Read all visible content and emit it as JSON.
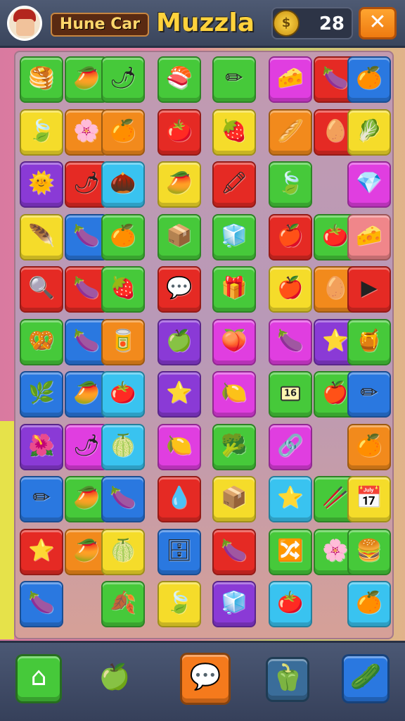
{
  "header": {
    "player_label": "Hune Car",
    "game_title": "Muzzla",
    "coin_symbol": "$",
    "coin_count": "28",
    "close_symbol": "✕"
  },
  "colors": {
    "green": "#46c93a",
    "orange": "#f28a1c",
    "yellow": "#f5dc2a",
    "red": "#e52a24",
    "purple": "#8a3ad6",
    "blue": "#2a78e0",
    "cyan": "#39c3f0",
    "magenta": "#e03ee0",
    "pink": "#f0868a"
  },
  "tiles": [
    {
      "col": 0,
      "row": 0,
      "color": "green",
      "icon": "🥞",
      "name": "pancake-icon"
    },
    {
      "col": 1,
      "row": 0,
      "color": "green",
      "icon": "🥭",
      "name": "mango-icon"
    },
    {
      "col": 2,
      "row": 0,
      "color": "green",
      "icon": "🌶",
      "name": "pepper-icon"
    },
    {
      "col": 3,
      "row": 0,
      "color": "green",
      "icon": "🍣",
      "name": "sushi-icon"
    },
    {
      "col": 4,
      "row": 0,
      "color": "green",
      "icon": "✏",
      "name": "pencil-icon"
    },
    {
      "col": 5,
      "row": 0,
      "color": "magenta",
      "icon": "🧀",
      "name": "cheese-icon"
    },
    {
      "col": 6,
      "row": 0,
      "color": "red",
      "icon": "🍆",
      "name": "eggplant-icon"
    },
    {
      "col": 7,
      "row": 0,
      "color": "blue",
      "icon": "🍊",
      "name": "orange-icon"
    },
    {
      "col": 0,
      "row": 1,
      "color": "yellow",
      "icon": "🍃",
      "name": "leaf-icon"
    },
    {
      "col": 1,
      "row": 1,
      "color": "orange",
      "icon": "🌸",
      "name": "flower-icon"
    },
    {
      "col": 2,
      "row": 1,
      "color": "orange",
      "icon": "🍊",
      "name": "orange-icon"
    },
    {
      "col": 3,
      "row": 1,
      "color": "red",
      "icon": "🍅",
      "name": "tomato-icon"
    },
    {
      "col": 4,
      "row": 1,
      "color": "yellow",
      "icon": "🍓",
      "name": "berry-icon"
    },
    {
      "col": 5,
      "row": 1,
      "color": "orange",
      "icon": "🥖",
      "name": "bread-icon"
    },
    {
      "col": 6,
      "row": 1,
      "color": "red",
      "icon": "🥚",
      "name": "egg-icon"
    },
    {
      "col": 7,
      "row": 1,
      "color": "yellow",
      "icon": "🥬",
      "name": "cabbage-icon"
    },
    {
      "col": 0,
      "row": 2,
      "color": "purple",
      "icon": "🌞",
      "name": "sun-icon"
    },
    {
      "col": 1,
      "row": 2,
      "color": "red",
      "icon": "🌶",
      "name": "pepper-icon"
    },
    {
      "col": 2,
      "row": 2,
      "color": "cyan",
      "icon": "🌰",
      "name": "chestnut-icon"
    },
    {
      "col": 3,
      "row": 2,
      "color": "yellow",
      "icon": "🥭",
      "name": "mango-icon"
    },
    {
      "col": 4,
      "row": 2,
      "color": "red",
      "icon": "🖍",
      "name": "crayon-icon"
    },
    {
      "col": 5,
      "row": 2,
      "color": "green",
      "icon": "🍃",
      "name": "leaf-icon"
    },
    {
      "col": 7,
      "row": 2,
      "color": "magenta",
      "icon": "💎",
      "name": "gem-icon"
    },
    {
      "col": 0,
      "row": 3,
      "color": "yellow",
      "icon": "🪶",
      "name": "feather-icon"
    },
    {
      "col": 1,
      "row": 3,
      "color": "blue",
      "icon": "🍆",
      "name": "plum-icon"
    },
    {
      "col": 2,
      "row": 3,
      "color": "green",
      "icon": "🍊",
      "name": "orange-icon"
    },
    {
      "col": 3,
      "row": 3,
      "color": "green",
      "icon": "📦",
      "name": "box-icon"
    },
    {
      "col": 4,
      "row": 3,
      "color": "green",
      "icon": "🧊",
      "name": "cube-icon"
    },
    {
      "col": 5,
      "row": 3,
      "color": "red",
      "icon": "🍎",
      "name": "apple-icon"
    },
    {
      "col": 6,
      "row": 3,
      "color": "green",
      "icon": "🍅",
      "name": "tomato-icon"
    },
    {
      "col": 7,
      "row": 3,
      "color": "pink",
      "icon": "🧀",
      "name": "cheese-icon"
    },
    {
      "col": 0,
      "row": 4,
      "color": "red",
      "icon": "🔍",
      "name": "magnifier-icon"
    },
    {
      "col": 1,
      "row": 4,
      "color": "red",
      "icon": "🍆",
      "name": "eggplant-icon"
    },
    {
      "col": 2,
      "row": 4,
      "color": "green",
      "icon": "🍓",
      "name": "strawberry-icon"
    },
    {
      "col": 3,
      "row": 4,
      "color": "red",
      "icon": "💬",
      "name": "speech-bubble-icon"
    },
    {
      "col": 4,
      "row": 4,
      "color": "green",
      "icon": "🎁",
      "name": "gift-box-icon"
    },
    {
      "col": 5,
      "row": 4,
      "color": "yellow",
      "icon": "🍎",
      "name": "apple-icon"
    },
    {
      "col": 6,
      "row": 4,
      "color": "orange",
      "icon": "🥚",
      "name": "egg-icon"
    },
    {
      "col": 7,
      "row": 4,
      "color": "red",
      "icon": "▶",
      "name": "play-icon"
    },
    {
      "col": 0,
      "row": 5,
      "color": "green",
      "icon": "🥨",
      "name": "pretzel-icon"
    },
    {
      "col": 1,
      "row": 5,
      "color": "blue",
      "icon": "🍆",
      "name": "plum-icon"
    },
    {
      "col": 2,
      "row": 5,
      "color": "orange",
      "icon": "🥫",
      "name": "can-icon"
    },
    {
      "col": 3,
      "row": 5,
      "color": "purple",
      "icon": "🍏",
      "name": "lime-icon"
    },
    {
      "col": 4,
      "row": 5,
      "color": "magenta",
      "icon": "🍑",
      "name": "peach-icon"
    },
    {
      "col": 5,
      "row": 5,
      "color": "magenta",
      "icon": "🍆",
      "name": "eggplant-icon"
    },
    {
      "col": 6,
      "row": 5,
      "color": "purple",
      "icon": "⭐",
      "name": "star-icon"
    },
    {
      "col": 7,
      "row": 5,
      "color": "green",
      "icon": "🍯",
      "name": "honey-icon"
    },
    {
      "col": 0,
      "row": 6,
      "color": "blue",
      "icon": "🌿",
      "name": "herb-icon"
    },
    {
      "col": 1,
      "row": 6,
      "color": "blue",
      "icon": "🥭",
      "name": "mango-icon"
    },
    {
      "col": 2,
      "row": 6,
      "color": "cyan",
      "icon": "🍅",
      "name": "tomato-icon"
    },
    {
      "col": 3,
      "row": 6,
      "color": "purple",
      "icon": "⭐",
      "name": "star-icon"
    },
    {
      "col": 4,
      "row": 6,
      "color": "magenta",
      "icon": "🍋",
      "name": "lemon-icon"
    },
    {
      "col": 5,
      "row": 6,
      "color": "green",
      "icon": "16",
      "name": "calendar-icon",
      "text": true
    },
    {
      "col": 6,
      "row": 6,
      "color": "green",
      "icon": "🍎",
      "name": "apple-icon"
    },
    {
      "col": 7,
      "row": 6,
      "color": "blue",
      "icon": "✏",
      "name": "pencil-icon"
    },
    {
      "col": 0,
      "row": 7,
      "color": "purple",
      "icon": "🌺",
      "name": "flower-icon"
    },
    {
      "col": 1,
      "row": 7,
      "color": "magenta",
      "icon": "🌶",
      "name": "pepper-icon"
    },
    {
      "col": 2,
      "row": 7,
      "color": "cyan",
      "icon": "🍈",
      "name": "melon-icon"
    },
    {
      "col": 3,
      "row": 7,
      "color": "magenta",
      "icon": "🍋",
      "name": "lemon-icon"
    },
    {
      "col": 4,
      "row": 7,
      "color": "green",
      "icon": "🥦",
      "name": "broccoli-icon"
    },
    {
      "col": 5,
      "row": 7,
      "color": "magenta",
      "icon": "🔗",
      "name": "chain-icon"
    },
    {
      "col": 7,
      "row": 7,
      "color": "orange",
      "icon": "🍊",
      "name": "orange-icon"
    },
    {
      "col": 0,
      "row": 8,
      "color": "blue",
      "icon": "✏",
      "name": "pencil-icon"
    },
    {
      "col": 1,
      "row": 8,
      "color": "green",
      "icon": "🥭",
      "name": "mango-icon"
    },
    {
      "col": 2,
      "row": 8,
      "color": "blue",
      "icon": "🍆",
      "name": "plum-icon"
    },
    {
      "col": 3,
      "row": 8,
      "color": "red",
      "icon": "💧",
      "name": "water-drop-icon"
    },
    {
      "col": 4,
      "row": 8,
      "color": "yellow",
      "icon": "📦",
      "name": "box-icon"
    },
    {
      "col": 5,
      "row": 8,
      "color": "cyan",
      "icon": "⭐",
      "name": "star-icon"
    },
    {
      "col": 6,
      "row": 8,
      "color": "green",
      "icon": "🥢",
      "name": "chopstick-icon"
    },
    {
      "col": 7,
      "row": 8,
      "color": "yellow",
      "icon": "📅",
      "name": "calendar-icon"
    },
    {
      "col": 0,
      "row": 9,
      "color": "red",
      "icon": "⭐",
      "name": "star-icon"
    },
    {
      "col": 1,
      "row": 9,
      "color": "orange",
      "icon": "🥭",
      "name": "mango-icon"
    },
    {
      "col": 2,
      "row": 9,
      "color": "yellow",
      "icon": "🍈",
      "name": "melon-icon"
    },
    {
      "col": 3,
      "row": 9,
      "color": "blue",
      "icon": "🗄",
      "name": "cabinet-icon"
    },
    {
      "col": 4,
      "row": 9,
      "color": "red",
      "icon": "🍆",
      "name": "eggplant-icon"
    },
    {
      "col": 5,
      "row": 9,
      "color": "green",
      "icon": "🔀",
      "name": "pipe-icon"
    },
    {
      "col": 6,
      "row": 9,
      "color": "green",
      "icon": "🌸",
      "name": "flower-icon"
    },
    {
      "col": 7,
      "row": 9,
      "color": "green",
      "icon": "🍔",
      "name": "burger-icon"
    },
    {
      "col": 0,
      "row": 10,
      "color": "blue",
      "icon": "🍆",
      "name": "plum-icon"
    },
    {
      "col": 2,
      "row": 10,
      "color": "green",
      "icon": "🍂",
      "name": "dry-leaf-icon"
    },
    {
      "col": 3,
      "row": 10,
      "color": "yellow",
      "icon": "🍃",
      "name": "leaf-icon"
    },
    {
      "col": 4,
      "row": 10,
      "color": "purple",
      "icon": "🧊",
      "name": "cube-icon"
    },
    {
      "col": 5,
      "row": 10,
      "color": "cyan",
      "icon": "🍅",
      "name": "tomato-icon"
    },
    {
      "col": 7,
      "row": 10,
      "color": "cyan",
      "icon": "🍊",
      "name": "orange-icon"
    }
  ],
  "bottom": {
    "home_icon": "⌂",
    "fruit_icon": "🍏",
    "hint_icon": "💬",
    "pepper_icon": "🫑",
    "boost_icon": "🥒"
  }
}
